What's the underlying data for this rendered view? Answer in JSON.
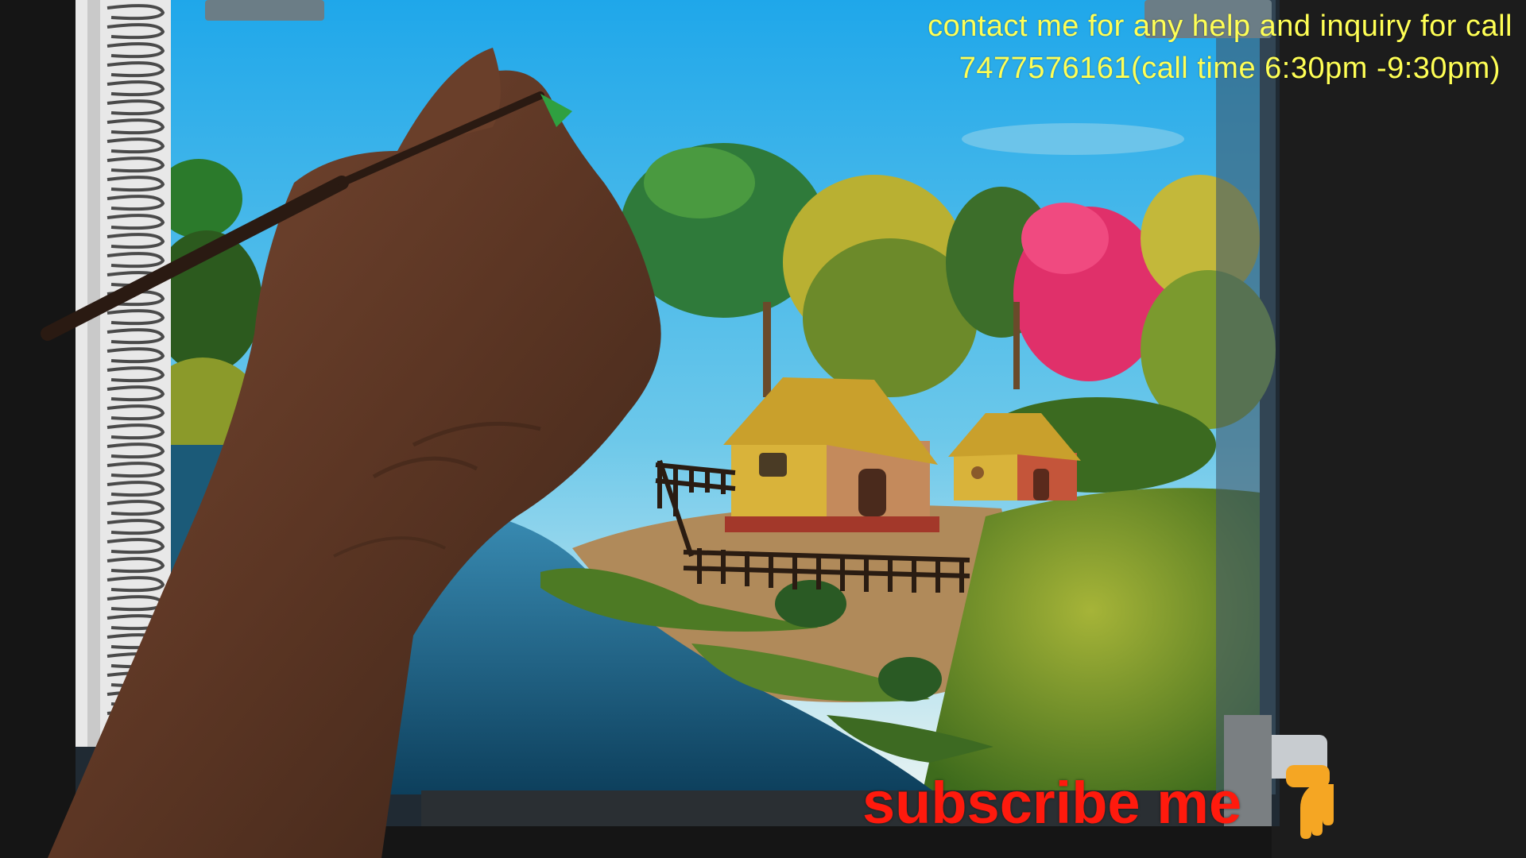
{
  "overlay": {
    "contact_line_1": "contact me for any help and inquiry for call",
    "contact_line_2": "7477576161(call time 6:30pm -9:30pm)",
    "subscribe_text": "subscribe me",
    "pointer_icon": "pointing-down-hand-icon"
  },
  "scene": {
    "subject": "painting-in-progress",
    "elements": [
      "sky",
      "trees",
      "huts",
      "fence",
      "river",
      "grass",
      "hand",
      "brush",
      "spiral-notebook"
    ]
  },
  "colors": {
    "contact_text": "#ffff55",
    "subscribe_text": "#ff1a0d",
    "pointer_icon": "#f5a623",
    "sky": "#2fb1e8",
    "water": "#1a6b92",
    "hut_wall": "#d9b33a",
    "hut_roof": "#c9a02c",
    "pink_tree": "#e0306a"
  }
}
